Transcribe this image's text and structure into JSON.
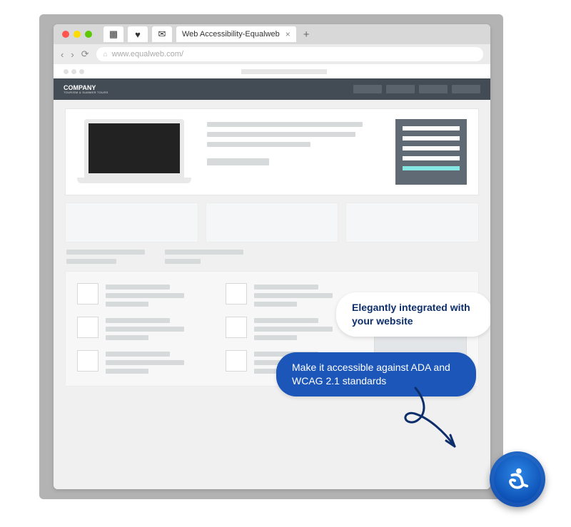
{
  "browser": {
    "tab_title": "Web Accessibility-Equalweb",
    "url": "www.equalweb.com/"
  },
  "site": {
    "logo_title": "COMPANY",
    "logo_subtitle": "TOURISM & SUMMER TOURS"
  },
  "callouts": {
    "integration": "Elegantly integrated with your website",
    "standards": "Make it accessible against ADA and WCAG 2.1 standards"
  },
  "icons": {
    "close": "×",
    "plus": "+",
    "back": "‹",
    "forward": "›",
    "reload": "⟳",
    "lock": "⌂",
    "grid": "▦",
    "heart": "♥",
    "mail": "✉"
  }
}
